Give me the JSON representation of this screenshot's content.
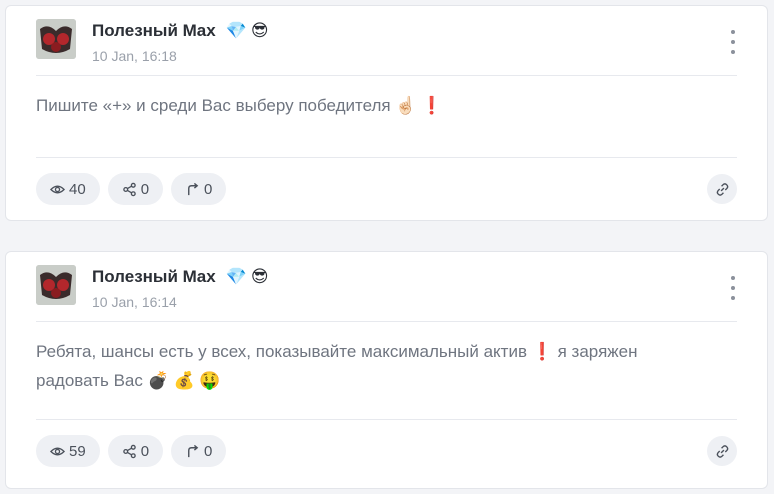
{
  "posts": [
    {
      "author": "Полезный Max",
      "author_emojis": [
        "💎",
        "😎"
      ],
      "time": "10 Jan, 16:18",
      "text": "Пишите «+» и среди Вас выберу победителя",
      "text_emojis": [
        "☝🏻",
        "❗"
      ],
      "views": "40",
      "shares": "0",
      "forwards": "0"
    },
    {
      "author": "Полезный Max",
      "author_emojis": [
        "💎",
        "😎"
      ],
      "time": "10 Jan, 16:14",
      "text_line1": "Ребята, шансы есть у всех, показывайте максимальный актив",
      "text_mid_emoji": "❗",
      "text_line1_end": "я заряжен",
      "text_line2": "радовать Вас",
      "text_emojis": [
        "💣",
        "💰",
        "🤑"
      ],
      "views": "59",
      "shares": "0",
      "forwards": "0"
    }
  ],
  "icons": {
    "views": "eye-icon",
    "shares": "share-icon",
    "forwards": "forward-arrow-icon",
    "link": "link-icon",
    "menu": "more-vertical-icon"
  },
  "colors": {
    "background": "#f3f4f7",
    "card": "#ffffff",
    "pill": "#eef0f4",
    "muted_text": "#6f7580",
    "accent_red": "#e0212e"
  }
}
